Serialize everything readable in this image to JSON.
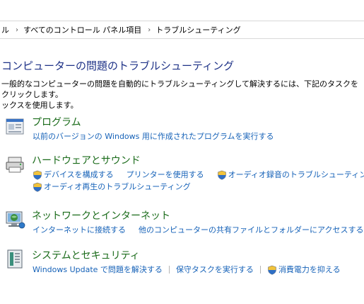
{
  "breadcrumb": {
    "items": [
      "ル",
      "すべてのコントロール パネル項目",
      "トラブルシューティング"
    ],
    "separator": "›"
  },
  "page": {
    "title": "コンピューターの問題のトラブルシューティング",
    "description_line1": "一般的なコンピューターの問題を自動的にトラブルシューティングして解決するには、下記のタスクをクリックします。",
    "description_line2": "ックスを使用します。"
  },
  "categories": [
    {
      "title": "プログラム",
      "icon": "programs-icon",
      "links": [
        "以前のバージョンの Windows 用に作成されたプログラムを実行する"
      ]
    },
    {
      "title": "ハードウェアとサウンド",
      "icon": "hardware-sound-icon",
      "links": [
        "デバイスを構成する",
        "プリンターを使用する",
        "オーディオ録音のトラブルシューティング",
        "オーディオ再生のトラブルシューティング"
      ]
    },
    {
      "title": "ネットワークとインターネット",
      "icon": "network-internet-icon",
      "links": [
        "インターネットに接続する",
        "他のコンピューターの共有ファイルとフォルダーにアクセスする"
      ]
    },
    {
      "title": "システムとセキュリティ",
      "icon": "system-security-icon",
      "links": [
        "Windows Update で問題を解決する",
        "保守タスクを実行する",
        "消費電力を抑える"
      ]
    }
  ],
  "colors": {
    "title_blue": "#1e3287",
    "category_green": "#1a6b1a",
    "link_blue": "#1662b8"
  }
}
